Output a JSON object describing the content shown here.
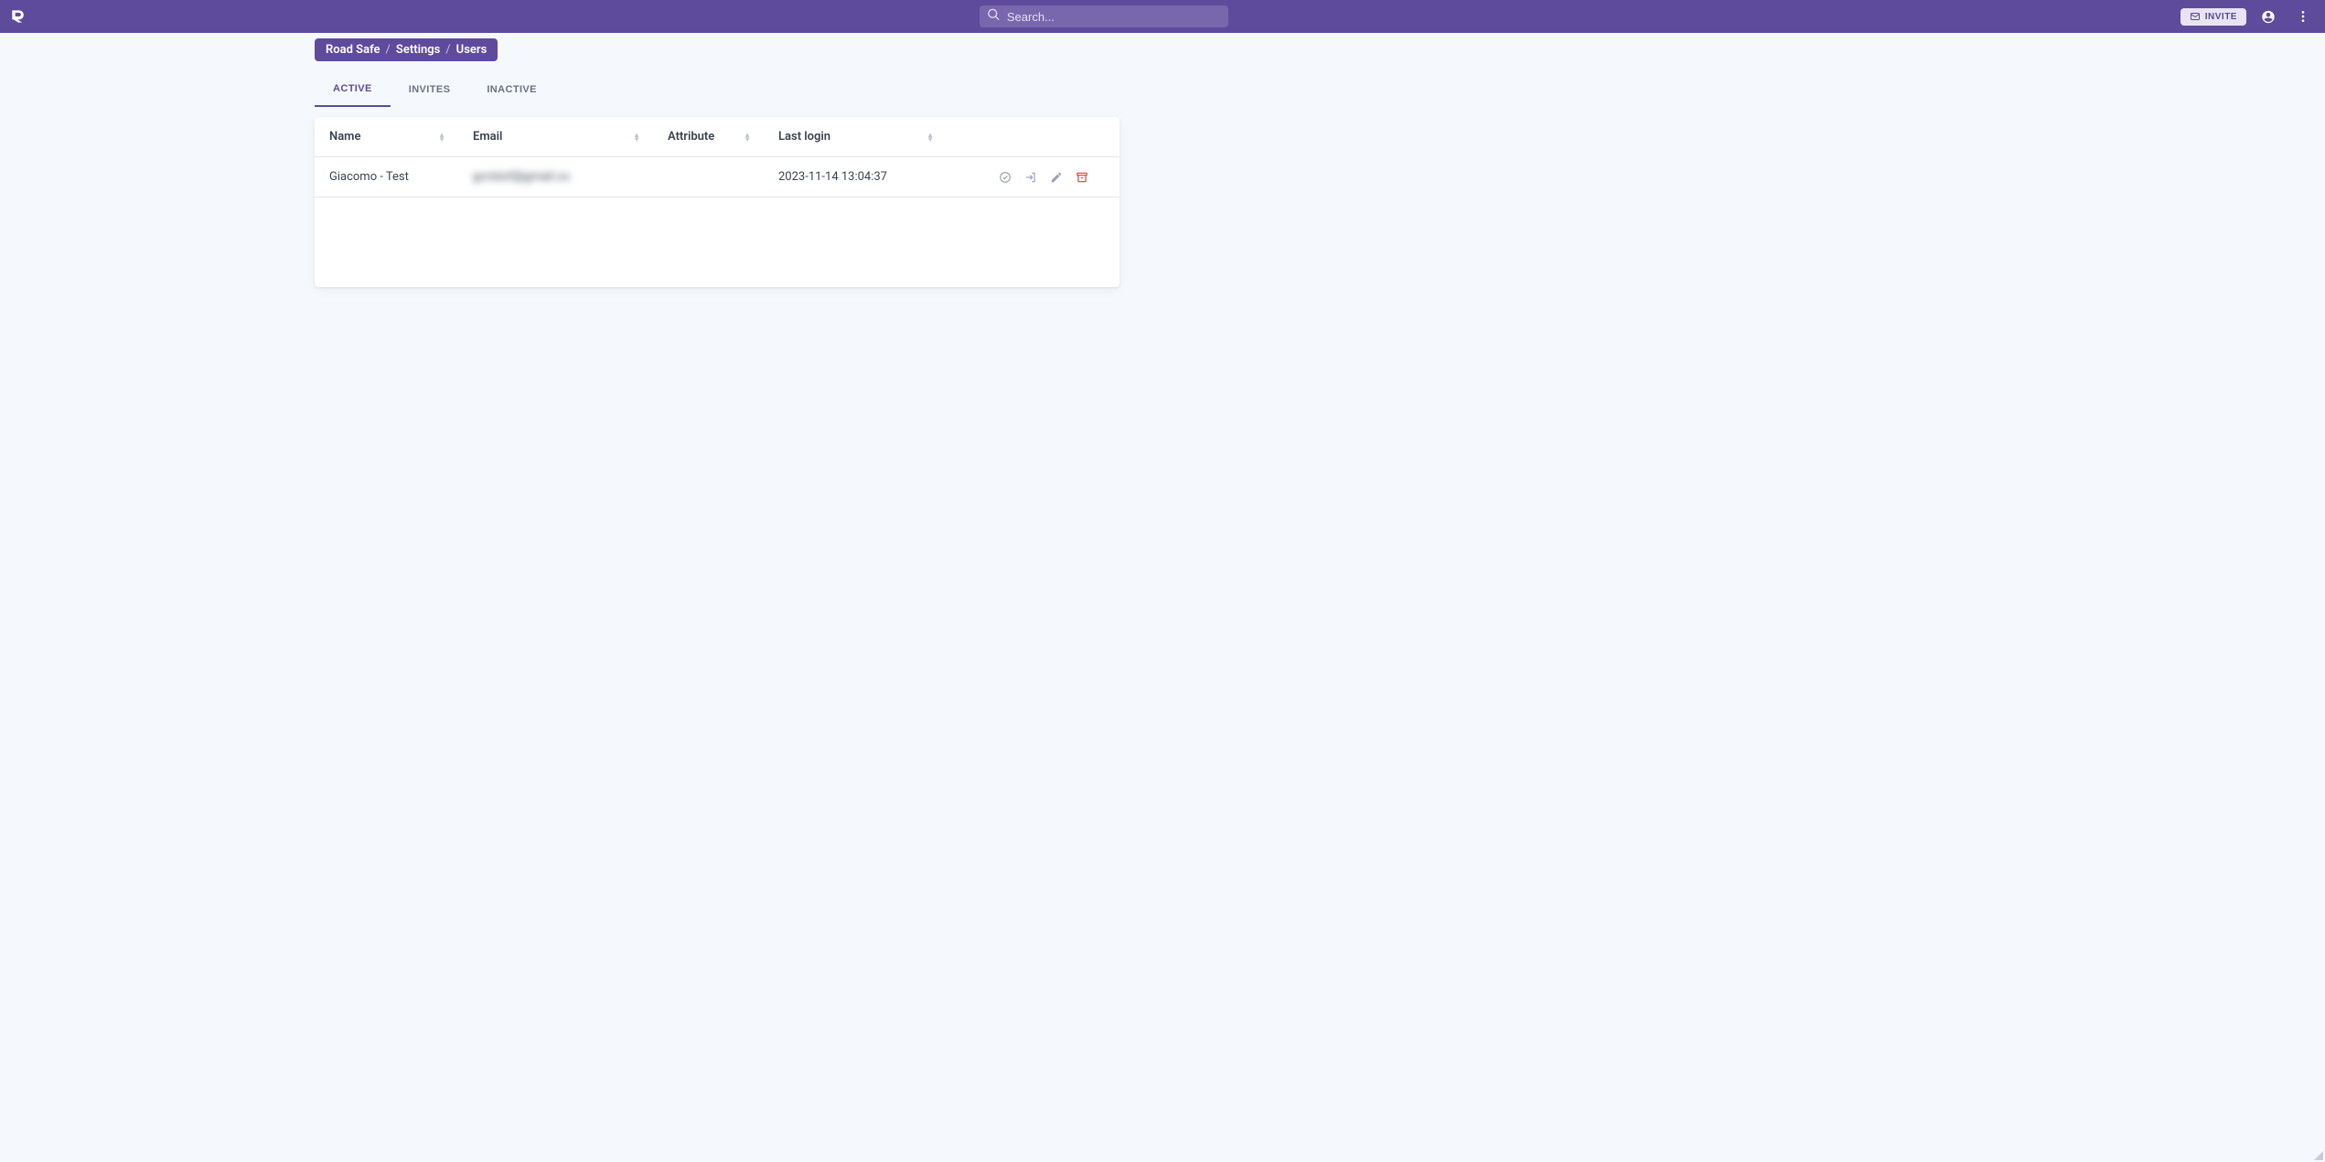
{
  "appbar": {
    "search_placeholder": "Search...",
    "invite_label": "Invite"
  },
  "breadcrumb": {
    "items": [
      "Road Safe",
      "Settings",
      "Users"
    ]
  },
  "tabs": {
    "items": [
      {
        "label": "Active",
        "active": true
      },
      {
        "label": "Invites",
        "active": false
      },
      {
        "label": "Inactive",
        "active": false
      }
    ]
  },
  "table": {
    "columns": {
      "name": "Name",
      "email": "Email",
      "attribute": "Attribute",
      "last_login": "Last login"
    },
    "rows": [
      {
        "name": "Giacomo - Test",
        "email": "gcristof@gmail.co",
        "attribute": "",
        "last_login": "2023-11-14 13:04:37"
      }
    ]
  },
  "icons": {
    "search": "search-icon",
    "mail": "mail-icon",
    "account": "account-circle-icon",
    "more": "more-vert-icon",
    "history": "restore-icon",
    "login": "login-icon",
    "edit": "edit-icon",
    "archive": "archive-icon"
  }
}
